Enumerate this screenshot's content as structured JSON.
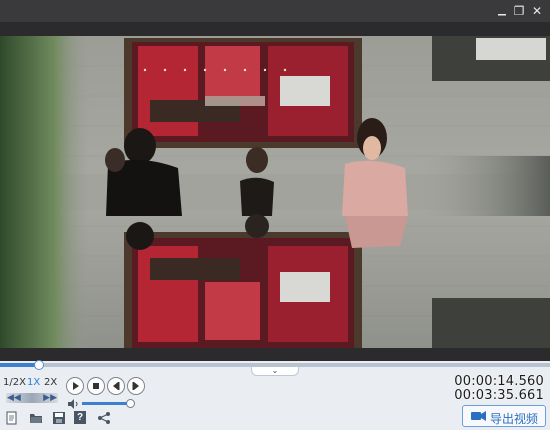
{
  "window": {
    "controls": [
      {
        "name": "restore-icon",
        "glyph": "❐"
      },
      {
        "name": "close-icon",
        "glyph": "✕"
      }
    ]
  },
  "player": {
    "progress": 0.07,
    "volume": 0.95,
    "speeds": [
      {
        "label": "1/2X",
        "active": false
      },
      {
        "label": "1X",
        "active": true
      },
      {
        "label": "2X",
        "active": false
      }
    ],
    "current_time": "00:00:14.560",
    "total_time": "00:03:35.661",
    "collapse_glyph": "⌄",
    "step_back_glyph": "◀◀",
    "step_forward_glyph": "▶▶"
  },
  "toolbar": {
    "icons": [
      "new-file-icon",
      "open-folder-icon",
      "save-icon",
      "help-icon",
      "share-icon"
    ],
    "export_label": "导出视频",
    "help_glyph": "?"
  },
  "colors": {
    "accent": "#3d7fd0",
    "title_bar": "#3a3a3c",
    "control_bar": "#eaedf1"
  }
}
